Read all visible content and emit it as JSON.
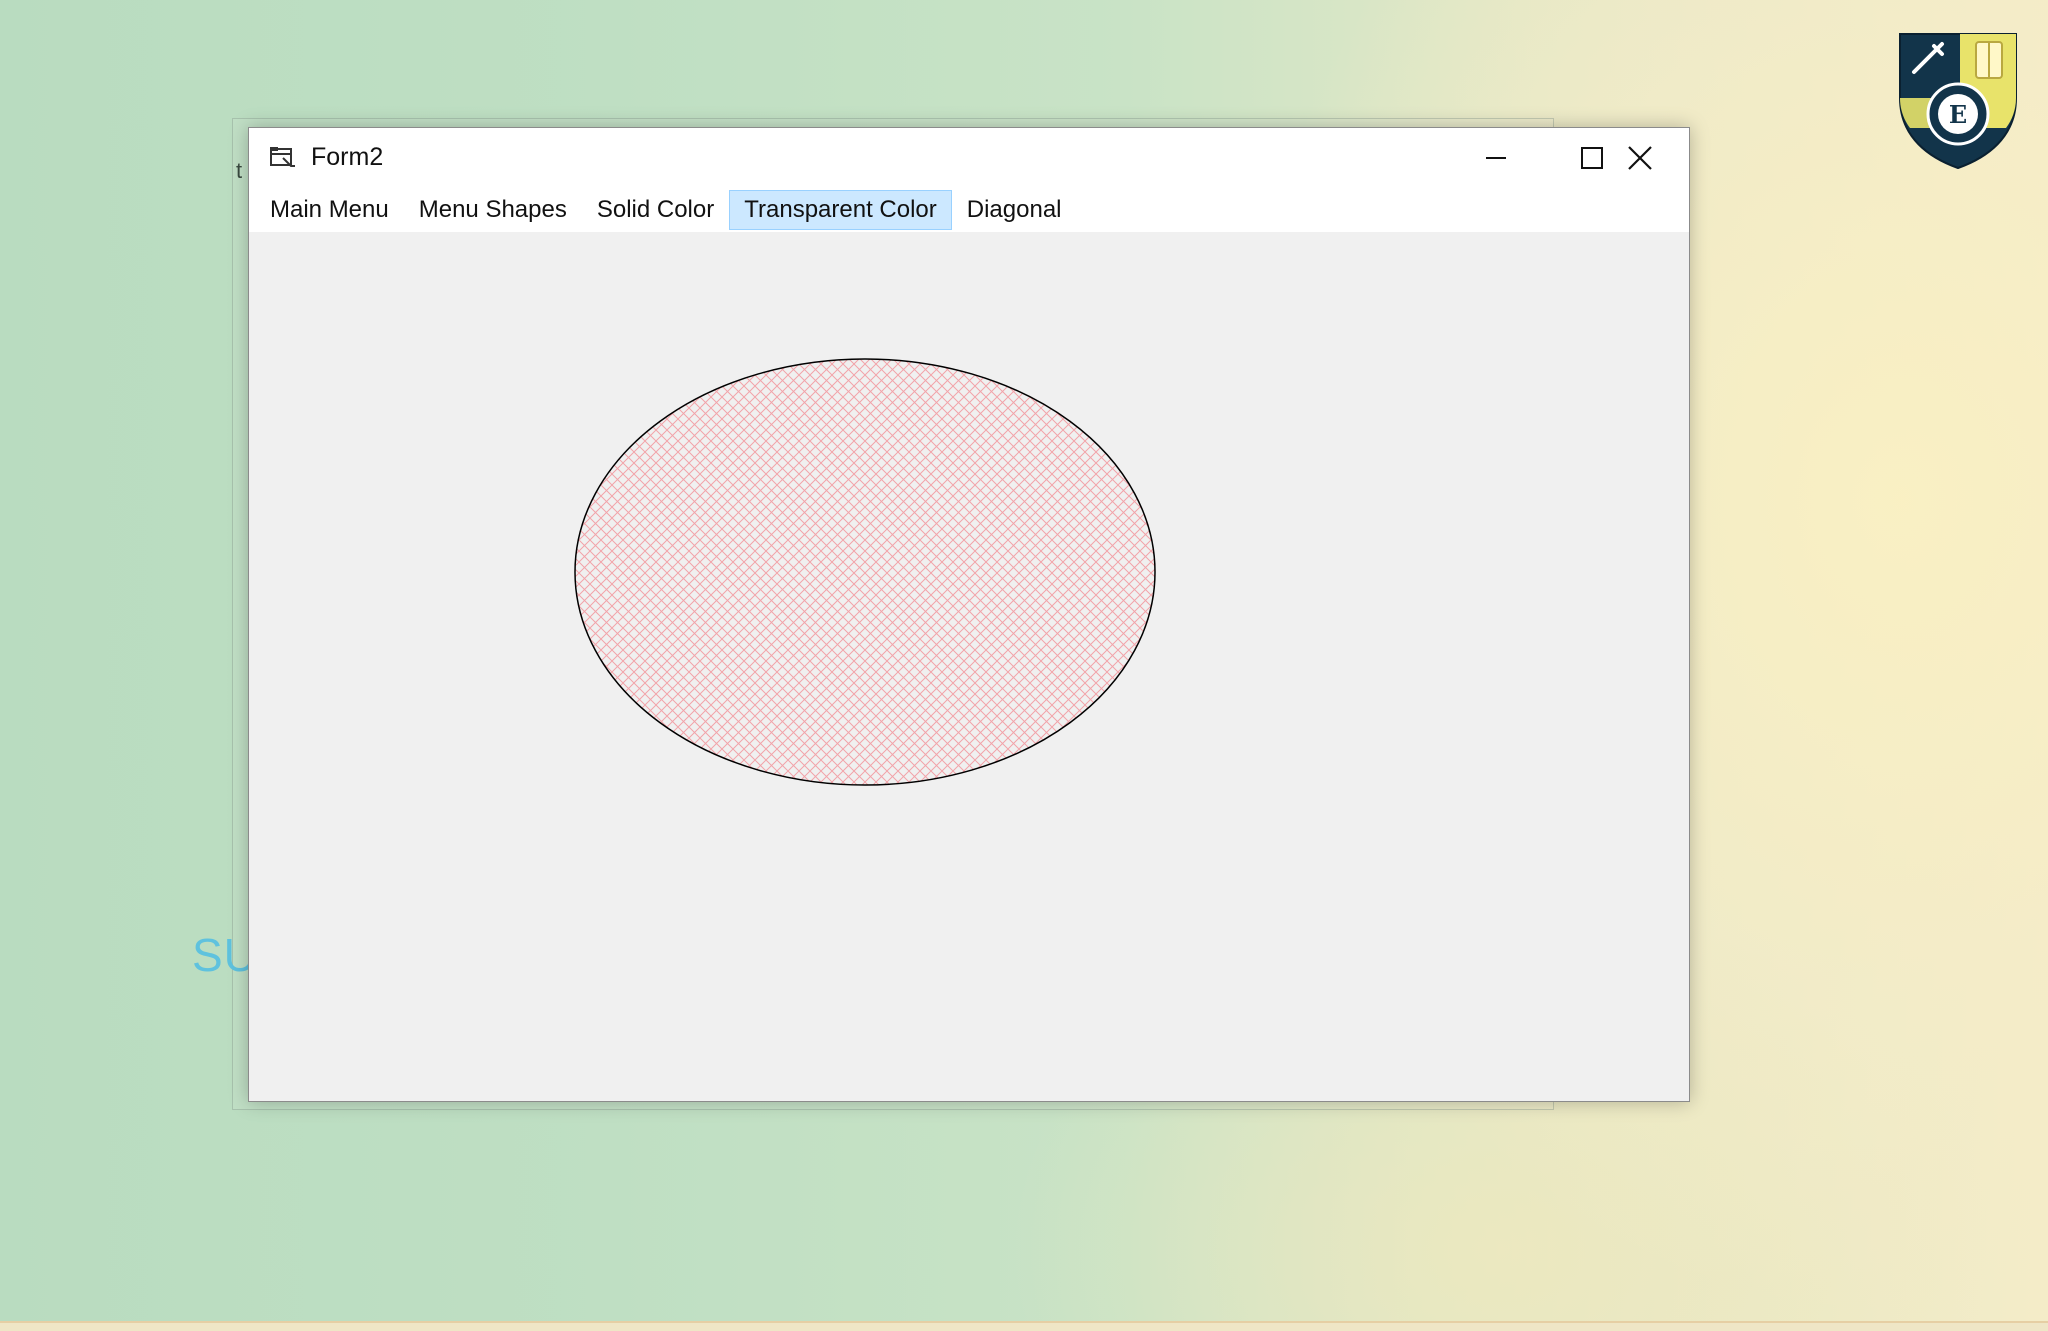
{
  "background": {
    "partial_text": "SU",
    "partial_letter": "t"
  },
  "window": {
    "title": "Form2",
    "controls": {
      "minimize_icon": "minimize-icon",
      "maximize_icon": "maximize-icon",
      "close_icon": "close-icon"
    }
  },
  "menu": {
    "items": [
      {
        "label": "Main Menu"
      },
      {
        "label": "Menu Shapes"
      },
      {
        "label": "Solid Color"
      },
      {
        "label": "Transparent Color",
        "active": true
      },
      {
        "label": "Diagonal"
      }
    ]
  },
  "canvas": {
    "shape": "ellipse",
    "fill_pattern": "diagonal-crosshatch",
    "hatch_color": "#f2a3a9",
    "outline_color": "#000000",
    "background_color": "#f0f0f0"
  },
  "colors": {
    "menu_highlight": "#cce8ff",
    "menu_highlight_border": "#99d1ff",
    "background_partial_text": "#5fc2de"
  }
}
